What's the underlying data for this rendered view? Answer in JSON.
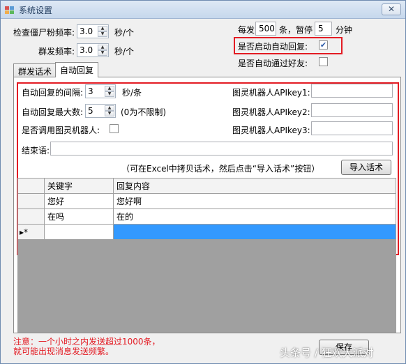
{
  "window": {
    "title": "系统设置",
    "close_glyph": "✕"
  },
  "top": {
    "zombie_rate_label": "检查僵尸粉频率:",
    "zombie_rate_value": "3.0",
    "zombie_rate_unit": "秒/个",
    "group_rate_label": "群发频率:",
    "group_rate_value": "3.0",
    "group_rate_unit": "秒/个",
    "per_send_label": "每发",
    "per_send_value": "500",
    "pause_label": "条，暂停",
    "pause_value": "5",
    "pause_unit": "分钟",
    "auto_reply_label": "是否启动自动回复:",
    "auto_reply_checked": true,
    "auto_accept_label": "是否自动通过好友:",
    "auto_accept_checked": false
  },
  "tabs": [
    {
      "label": "群发话术",
      "active": false
    },
    {
      "label": "自动回复",
      "active": true
    }
  ],
  "reply": {
    "interval_label": "自动回复的间隔:",
    "interval_value": "3",
    "interval_unit": "秒/条",
    "max_label": "自动回复最大数:",
    "max_value": "5",
    "max_hint": "(0为不限制)",
    "use_robot_label": "是否调用图灵机器人:",
    "use_robot_checked": false,
    "key1_label": "图灵机器人APIkey1:",
    "key1_value": "",
    "key2_label": "图灵机器人APIkey2:",
    "key2_value": "",
    "key3_label": "图灵机器人APIkey3:",
    "key3_value": "",
    "end_label": "结束语:",
    "end_value": "",
    "import_hint": "（可在Excel中拷贝话术，然后点击“导入话术”按钮）",
    "import_button": "导入话术"
  },
  "grid": {
    "columns": [
      "关键字",
      "回复内容"
    ],
    "rows": [
      {
        "keyword": "您好",
        "reply": "您好啊"
      },
      {
        "keyword": "在吗",
        "reply": "在的"
      }
    ],
    "new_row_marker": "▸*"
  },
  "footer": {
    "warn_line1": "注意：一个小时之内发送超过1000条，",
    "warn_line2": "就可能出现消息发送频繁。",
    "save_button": "保存",
    "watermark": "头条号 / 狂欢大派对"
  },
  "colors": {
    "highlight": "#e31b23",
    "selection": "#3399ff"
  }
}
